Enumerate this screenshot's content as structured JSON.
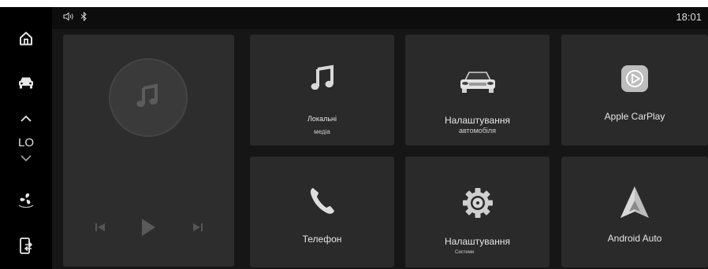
{
  "status": {
    "time": "18:01"
  },
  "sidebar": {
    "temp_value": "LO"
  },
  "tiles": {
    "local_media": {
      "label": "Локальні",
      "sub": "медіа"
    },
    "car_settings": {
      "label": "Налаштування",
      "sub": "автомобіля"
    },
    "carplay": {
      "label": "Apple CarPlay"
    },
    "phone": {
      "label": "Телефон"
    },
    "system_settings": {
      "label": "Налаштування",
      "sub": "Системи"
    },
    "android_auto": {
      "label": "Android Auto"
    }
  },
  "colors": {
    "background": "#0d0d0d",
    "tile": "#2a2a2a",
    "media_card": "#2d2d2d"
  }
}
